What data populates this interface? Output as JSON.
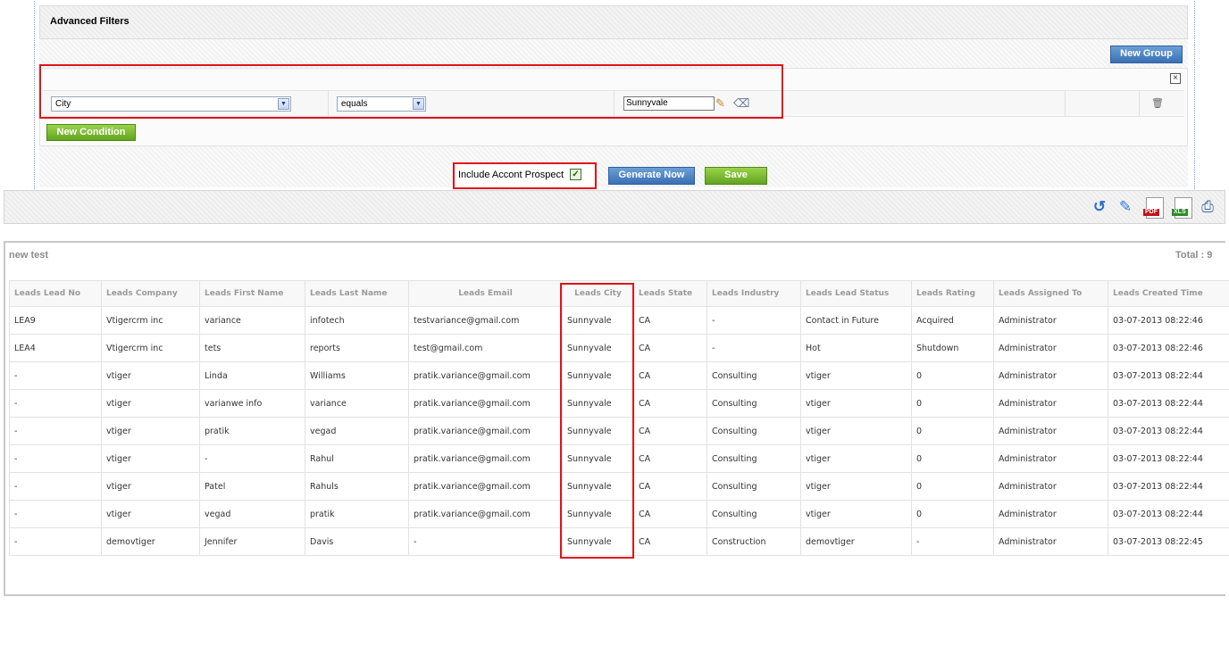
{
  "filters": {
    "title": "Advanced Filters",
    "new_group_label": "New Group",
    "close_symbol": "×",
    "new_condition_label": "New Condition",
    "condition": {
      "field": "City",
      "operator": "equals",
      "value": "Sunnyvale"
    },
    "include_label": "Include Accont Prospect",
    "include_checked": true,
    "generate_label": "Generate Now",
    "save_label": "Save"
  },
  "toolbar": {
    "icons": [
      "refresh-icon",
      "edit-icon",
      "pdf-export-icon",
      "excel-export-icon",
      "print-icon"
    ],
    "pdf_text": "PDF",
    "xls_text": "XLS"
  },
  "report": {
    "title": "new test",
    "total": "Total : 9",
    "columns": [
      "Leads Lead No",
      "Leads Company",
      "Leads First Name",
      "Leads Last Name",
      "Leads Email",
      "Leads City",
      "Leads State",
      "Leads Industry",
      "Leads Lead Status",
      "Leads Rating",
      "Leads Assigned To",
      "Leads Created Time"
    ],
    "rows": [
      [
        "LEA9",
        "Vtigercrm inc",
        "variance",
        "infotech",
        "testvariance@gmail.com",
        "Sunnyvale",
        "CA",
        "-",
        "Contact in Future",
        "Acquired",
        "Administrator",
        "03-07-2013 08:22:46"
      ],
      [
        "LEA4",
        "Vtigercrm inc",
        "tets",
        "reports",
        "test@gmail.com",
        "Sunnyvale",
        "CA",
        "-",
        "Hot",
        "Shutdown",
        "Administrator",
        "03-07-2013 08:22:46"
      ],
      [
        "-",
        "vtiger",
        "Linda",
        "Williams",
        "pratik.variance@gmail.com",
        "Sunnyvale",
        "CA",
        "Consulting",
        "vtiger",
        "0",
        "Administrator",
        "03-07-2013 08:22:44"
      ],
      [
        "-",
        "vtiger",
        "varianwe info",
        "variance",
        "pratik.variance@gmail.com",
        "Sunnyvale",
        "CA",
        "Consulting",
        "vtiger",
        "0",
        "Administrator",
        "03-07-2013 08:22:44"
      ],
      [
        "-",
        "vtiger",
        "pratik",
        "vegad",
        "pratik.variance@gmail.com",
        "Sunnyvale",
        "CA",
        "Consulting",
        "vtiger",
        "0",
        "Administrator",
        "03-07-2013 08:22:44"
      ],
      [
        "-",
        "vtiger",
        "-",
        "Rahul",
        "pratik.variance@gmail.com",
        "Sunnyvale",
        "CA",
        "Consulting",
        "vtiger",
        "0",
        "Administrator",
        "03-07-2013 08:22:44"
      ],
      [
        "-",
        "vtiger",
        "Patel",
        "Rahuls",
        "pratik.variance@gmail.com",
        "Sunnyvale",
        "CA",
        "Consulting",
        "vtiger",
        "0",
        "Administrator",
        "03-07-2013 08:22:44"
      ],
      [
        "-",
        "vtiger",
        "vegad",
        "pratik",
        "pratik.variance@gmail.com",
        "Sunnyvale",
        "CA",
        "Consulting",
        "vtiger",
        "0",
        "Administrator",
        "03-07-2013 08:22:44"
      ],
      [
        "-",
        "demovtiger",
        "Jennifer",
        "Davis",
        "-",
        "Sunnyvale",
        "CA",
        "Construction",
        "demovtiger",
        "-",
        "Administrator",
        "03-07-2013 08:22:45"
      ]
    ]
  },
  "colors": {
    "highlight": "#e0141b",
    "button_blue": "#3a70b5",
    "button_green": "#62a41f"
  }
}
